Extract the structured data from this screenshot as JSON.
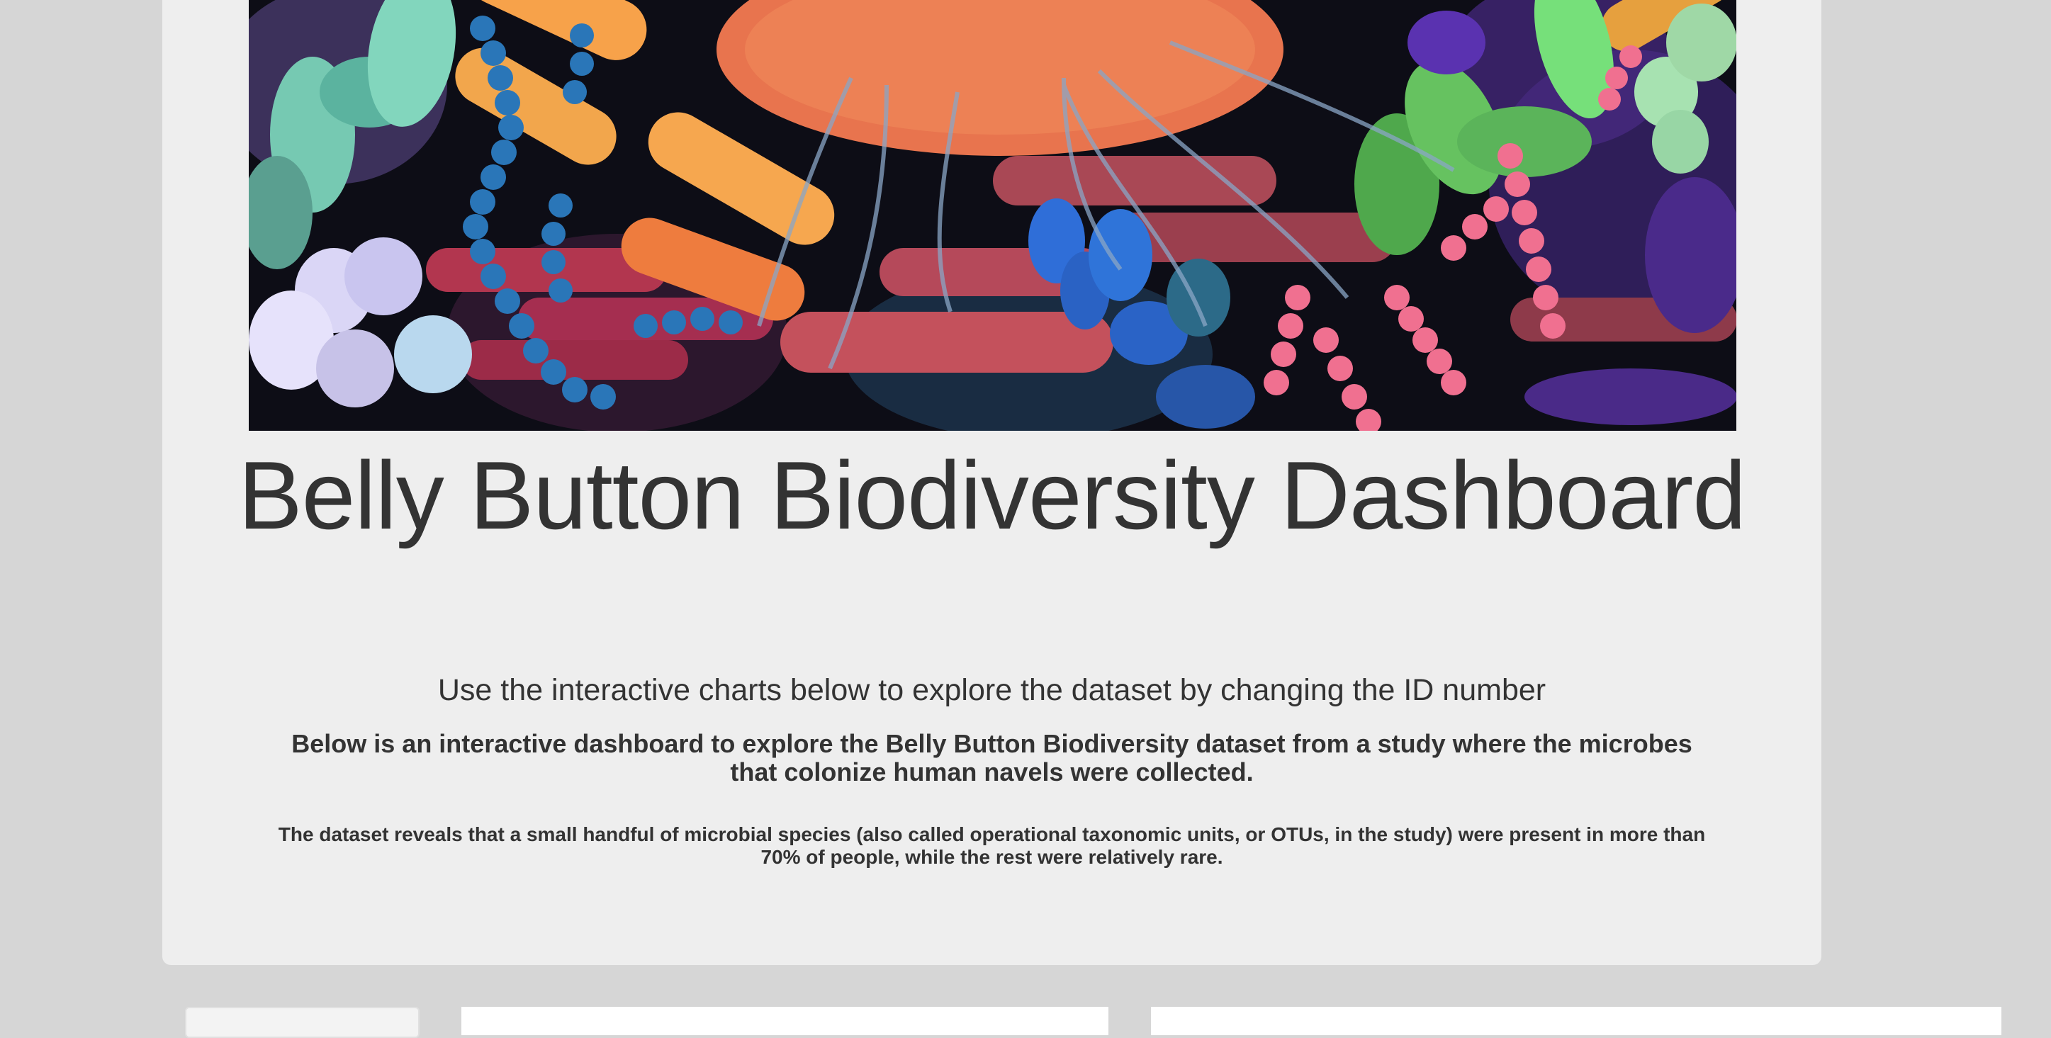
{
  "jumbotron": {
    "title": "Belly Button Biodiversity Dashboard",
    "lead": "Use the interactive charts below to explore the dataset by changing the ID number",
    "intro": "Below is an interactive dashboard to explore the Belly Button Biodiversity dataset from a study where the microbes that colonize human navels were collected.",
    "description": "The dataset reveals that a small handful of microbial species (also called operational taxonomic units, or OTUs, in the study) were present in more than 70% of people, while the rest were relatively rare."
  },
  "colors": {
    "page_background": "#d6d6d6",
    "jumbotron_background": "#eeeeee",
    "text": "#333333",
    "panel_background": "#ffffff"
  }
}
